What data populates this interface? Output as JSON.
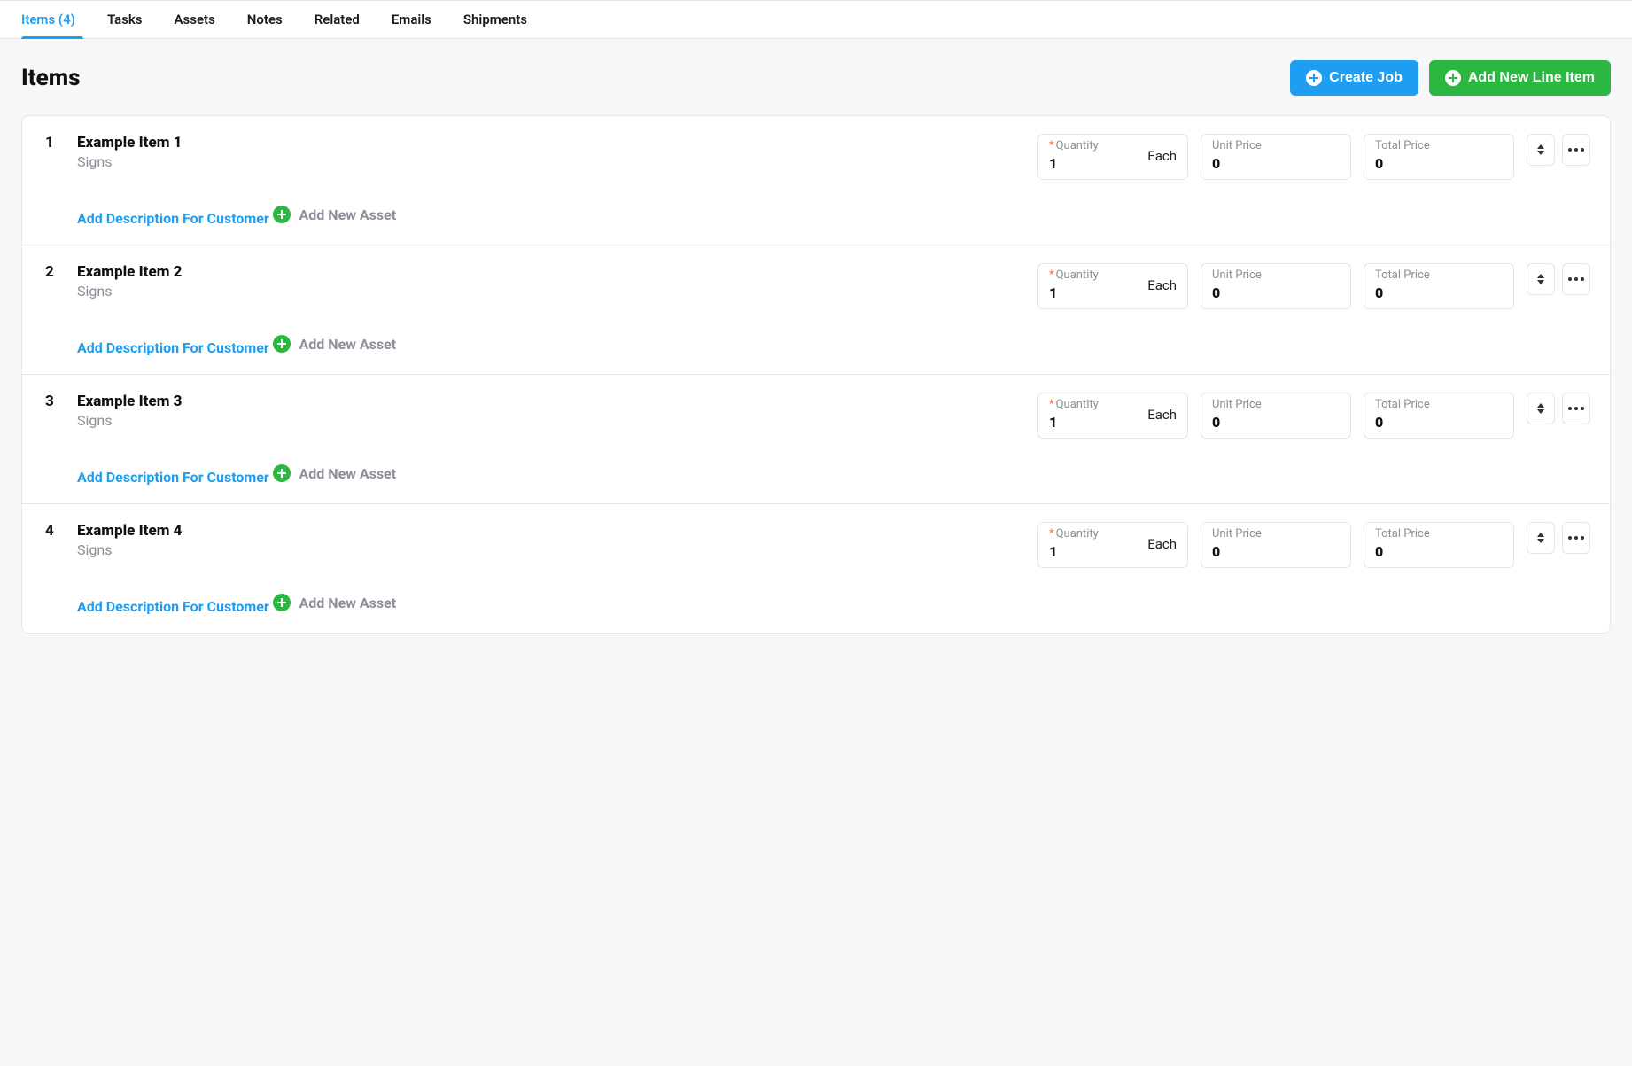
{
  "tabs": [
    {
      "label": "Items (4)",
      "active": true
    },
    {
      "label": "Tasks",
      "active": false
    },
    {
      "label": "Assets",
      "active": false
    },
    {
      "label": "Notes",
      "active": false
    },
    {
      "label": "Related",
      "active": false
    },
    {
      "label": "Emails",
      "active": false
    },
    {
      "label": "Shipments",
      "active": false
    }
  ],
  "page_title": "Items",
  "buttons": {
    "create_job": "Create Job",
    "add_line_item": "Add New Line Item"
  },
  "field_labels": {
    "quantity": "Quantity",
    "unit_price": "Unit Price",
    "total_price": "Total Price"
  },
  "links": {
    "add_description": "Add Description For Customer",
    "add_asset": "Add New Asset"
  },
  "items": [
    {
      "index": "1",
      "name": "Example Item 1",
      "category": "Signs",
      "quantity": "1",
      "unit": "Each",
      "unit_price": "0",
      "total_price": "0"
    },
    {
      "index": "2",
      "name": "Example Item 2",
      "category": "Signs",
      "quantity": "1",
      "unit": "Each",
      "unit_price": "0",
      "total_price": "0"
    },
    {
      "index": "3",
      "name": "Example Item 3",
      "category": "Signs",
      "quantity": "1",
      "unit": "Each",
      "unit_price": "0",
      "total_price": "0"
    },
    {
      "index": "4",
      "name": "Example Item 4",
      "category": "Signs",
      "quantity": "1",
      "unit": "Each",
      "unit_price": "0",
      "total_price": "0"
    }
  ]
}
